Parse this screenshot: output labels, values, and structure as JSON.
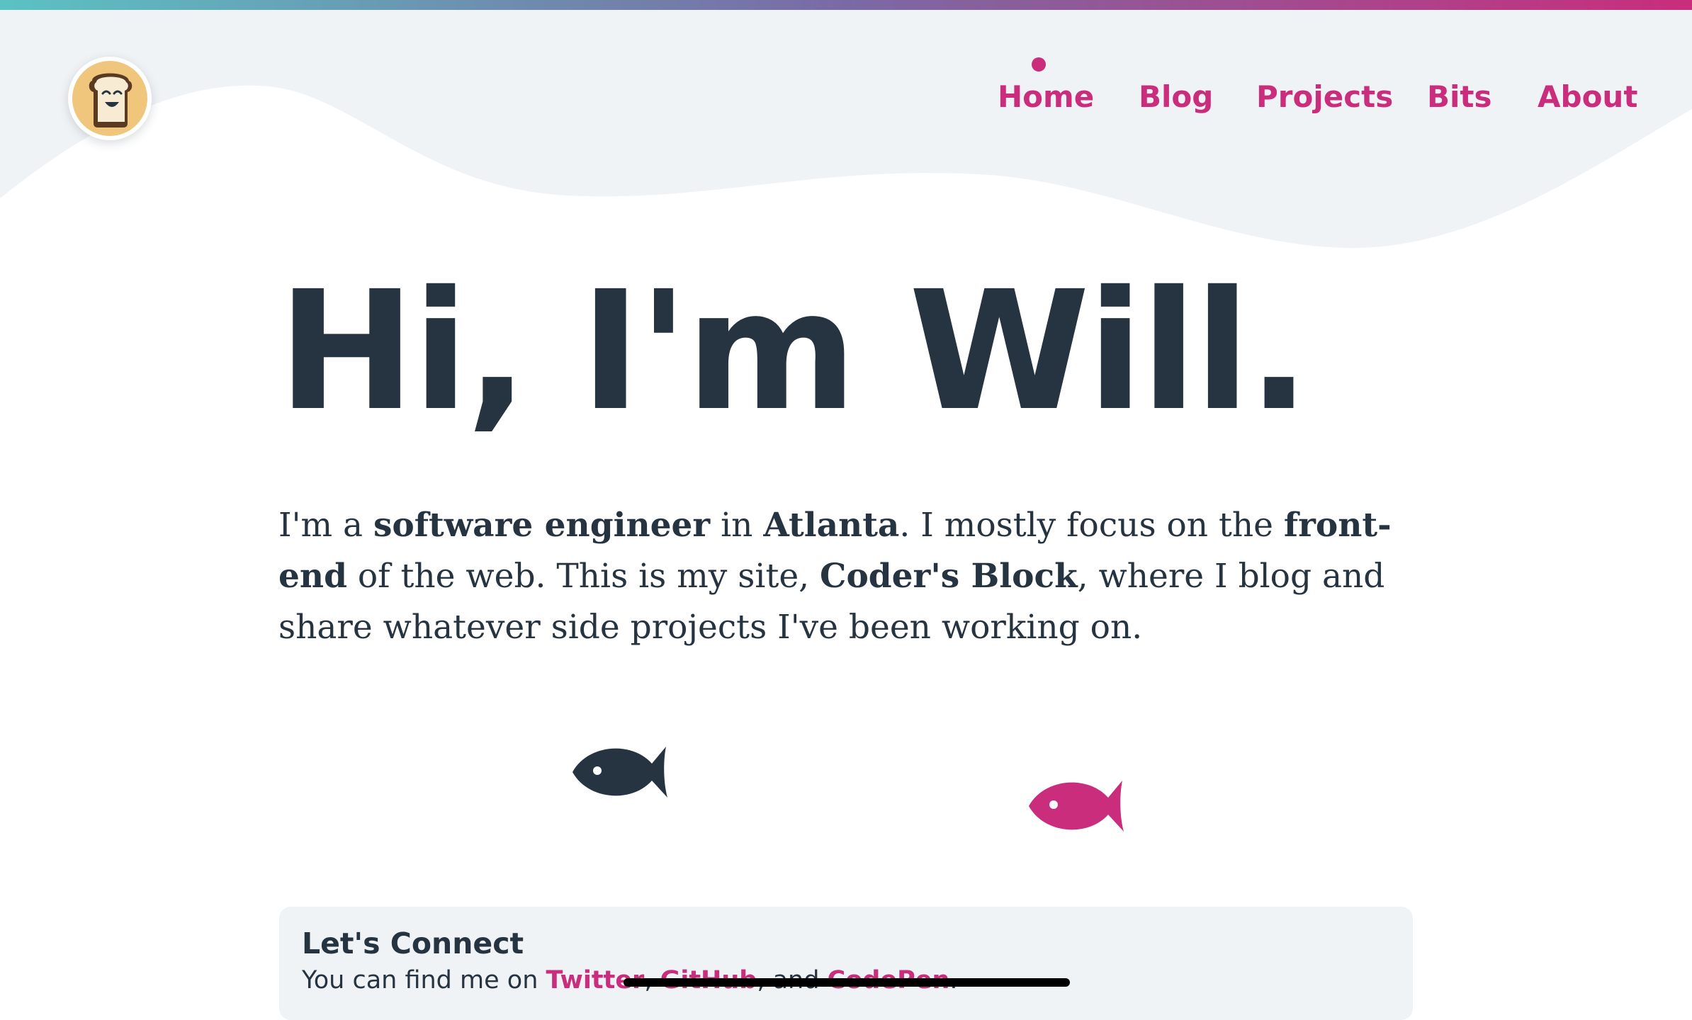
{
  "header": {
    "logo_alt": "Coder's Block",
    "nav": [
      {
        "label": "Home",
        "active": true
      },
      {
        "label": "Blog",
        "active": false
      },
      {
        "label": "Projects",
        "active": false
      },
      {
        "label": "Bits",
        "active": false
      },
      {
        "label": "About",
        "active": false
      }
    ]
  },
  "hero": {
    "title": "Hi, I'm Will.",
    "intro": {
      "t1": "I'm a ",
      "b1": "software engineer",
      "t2": " in ",
      "b2": "Atlanta",
      "t3": ". I mostly focus on the ",
      "b3": "front-end",
      "t4": " of the web. This is my site, ",
      "b4": "Coder's Block",
      "t5": ", where I blog and share whatever side projects I've been working on."
    }
  },
  "connect": {
    "title": "Let's Connect",
    "prefix": "You can find me on ",
    "links": [
      "Twitter",
      "GitHub",
      "CodePen"
    ],
    "sep1": ", ",
    "sep2": ", and ",
    "suffix": "."
  },
  "colors": {
    "accent": "#c92d7c",
    "text": "#263441",
    "wave_bg": "#f0f3f6",
    "logo_bg": "#f0c67d"
  },
  "icons": [
    "toast-logo-icon",
    "fish-icon-dark",
    "fish-icon-pink"
  ]
}
